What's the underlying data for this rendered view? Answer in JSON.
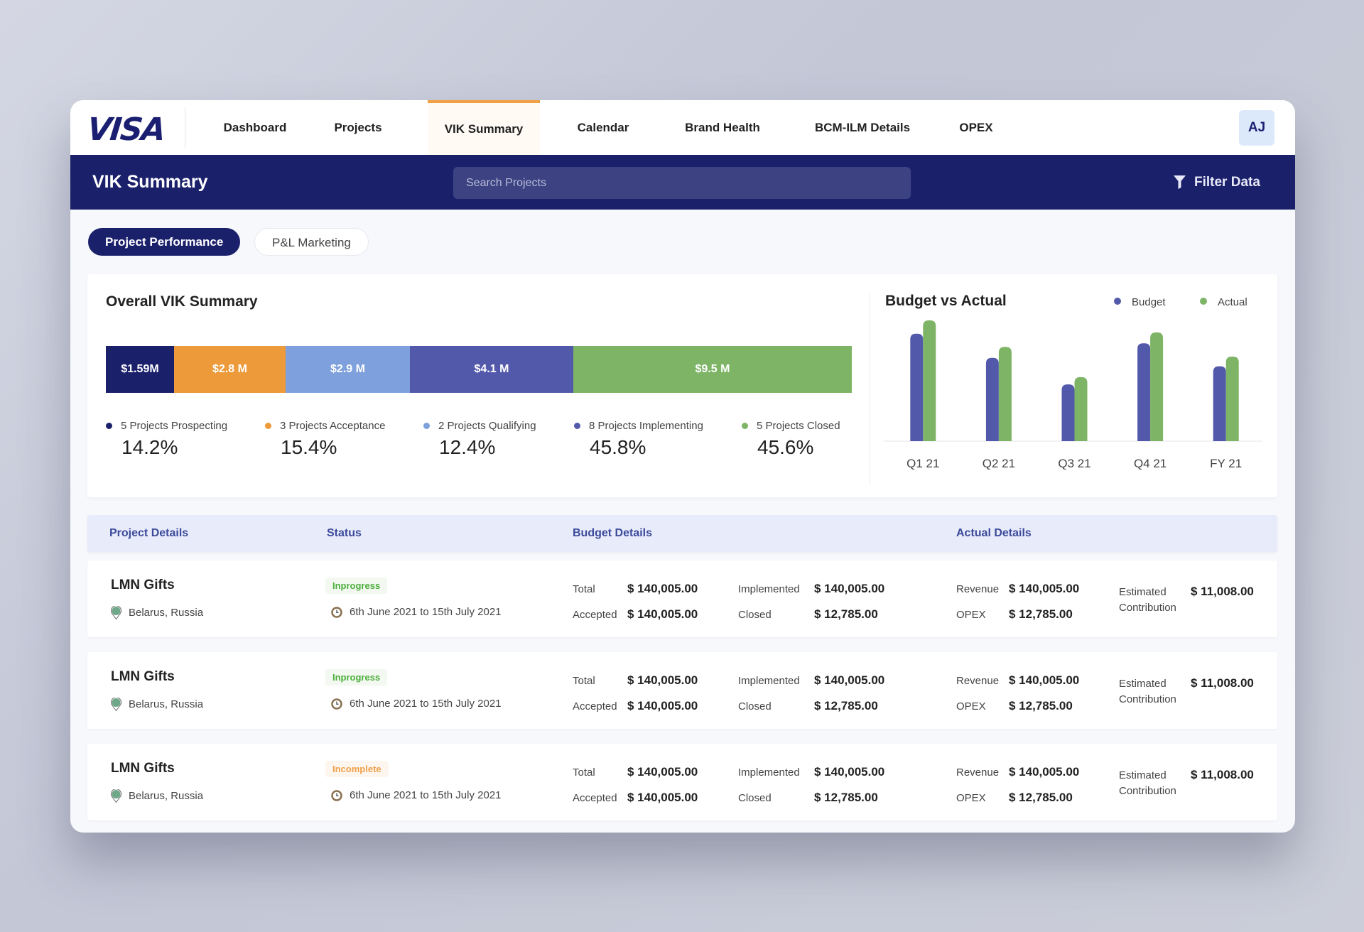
{
  "nav": {
    "logo": "VISA",
    "items": [
      {
        "label": "Dashboard",
        "active": false
      },
      {
        "label": "Projects",
        "active": false
      },
      {
        "label": "VIK Summary",
        "active": true
      },
      {
        "label": "Calendar",
        "active": false
      },
      {
        "label": "Brand Health",
        "active": false
      },
      {
        "label": "BCM-ILM Details",
        "active": false
      },
      {
        "label": "OPEX",
        "active": false
      }
    ],
    "avatar_initials": "AJ"
  },
  "header": {
    "title": "VIK Summary",
    "search_placeholder": "Search Projects",
    "search_value": "",
    "filter_label": "Filter Data",
    "filter_icon": "funnel-icon"
  },
  "tabs": [
    {
      "label": "Project Performance",
      "active": true
    },
    {
      "label": "P&L Marketing",
      "active": false
    }
  ],
  "summary": {
    "title": "Overall VIK Summary",
    "segments": [
      {
        "label": "$1.59M",
        "value_musd": 1.59,
        "color": "#1b206b",
        "count_label": "5 Projects Prospecting",
        "percent": "14.2%"
      },
      {
        "label": "$2.8 M",
        "value_musd": 2.8,
        "color": "#ec9a3a",
        "count_label": "3 Projects Acceptance",
        "percent": "15.4%"
      },
      {
        "label": "$2.9 M",
        "value_musd": 2.9,
        "color": "#7ea0dc",
        "count_label": "2 Projects Qualifying",
        "percent": "12.4%"
      },
      {
        "label": "$4.1 M",
        "value_musd": 4.1,
        "color": "#5359aa",
        "count_label": "8 Projects Implementing",
        "percent": "45.8%"
      },
      {
        "label": "$9.5 M",
        "value_musd": 9.5,
        "color": "#7db465",
        "count_label": "5 Projects Closed",
        "percent": "45.6%"
      }
    ]
  },
  "chart_data": {
    "type": "bar",
    "title": "Budget vs Actual",
    "categories": [
      "Q1 21",
      "Q2 21",
      "Q3 21",
      "Q4 21",
      "FY 21"
    ],
    "series": [
      {
        "name": "Budget",
        "color": "#5359aa",
        "values": [
          89,
          69,
          47,
          81,
          62
        ]
      },
      {
        "name": "Actual",
        "color": "#7db465",
        "values": [
          100,
          78,
          53,
          90,
          70
        ]
      }
    ],
    "xlabel": "",
    "ylabel": "",
    "ylim": [
      0,
      100
    ],
    "grid": false,
    "legend": "top-right",
    "note": "No y-axis shown; values are relative bar heights"
  },
  "table": {
    "headers": [
      "Project Details",
      "Status",
      "Budget Details",
      "Actual Details"
    ],
    "rows": [
      {
        "name": "LMN Gifts",
        "location": "Belarus, Russia",
        "status": "Inprogress",
        "status_type": "inprogress",
        "dates": "6th June 2021 to 15th July 2021",
        "budget": {
          "total_label": "Total",
          "total": "$ 140,005.00",
          "accepted_label": "Accepted",
          "accepted": "$ 140,005.00",
          "implemented_label": "Implemented",
          "implemented": "$ 140,005.00",
          "closed_label": "Closed",
          "closed": "$ 12,785.00"
        },
        "actual": {
          "revenue_label": "Revenue",
          "revenue": "$ 140,005.00",
          "opex_label": "OPEX",
          "opex": "$ 12,785.00",
          "est_label": "Estimated Contribution",
          "est": "$ 11,008.00"
        }
      },
      {
        "name": "LMN Gifts",
        "location": "Belarus, Russia",
        "status": "Inprogress",
        "status_type": "inprogress",
        "dates": "6th June 2021 to 15th July 2021",
        "budget": {
          "total_label": "Total",
          "total": "$ 140,005.00",
          "accepted_label": "Accepted",
          "accepted": "$ 140,005.00",
          "implemented_label": "Implemented",
          "implemented": "$ 140,005.00",
          "closed_label": "Closed",
          "closed": "$ 12,785.00"
        },
        "actual": {
          "revenue_label": "Revenue",
          "revenue": "$ 140,005.00",
          "opex_label": "OPEX",
          "opex": "$ 12,785.00",
          "est_label": "Estimated Contribution",
          "est": "$ 11,008.00"
        }
      },
      {
        "name": "LMN Gifts",
        "location": "Belarus, Russia",
        "status": "Incomplete",
        "status_type": "incomplete",
        "dates": "6th June 2021 to 15th July 2021",
        "budget": {
          "total_label": "Total",
          "total": "$ 140,005.00",
          "accepted_label": "Accepted",
          "accepted": "$ 140,005.00",
          "implemented_label": "Implemented",
          "implemented": "$ 140,005.00",
          "closed_label": "Closed",
          "closed": "$ 12,785.00"
        },
        "actual": {
          "revenue_label": "Revenue",
          "revenue": "$ 140,005.00",
          "opex_label": "OPEX",
          "opex": "$ 12,785.00",
          "est_label": "Estimated Contribution",
          "est": "$ 11,008.00"
        }
      }
    ]
  }
}
